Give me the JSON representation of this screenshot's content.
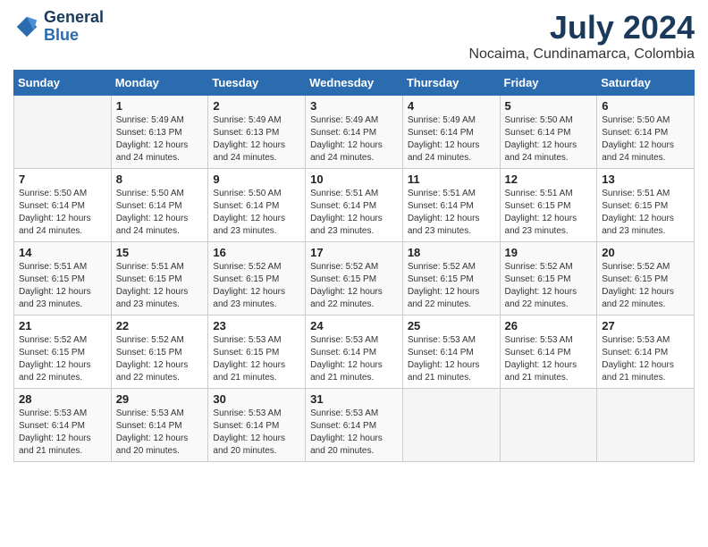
{
  "header": {
    "logo_line1": "General",
    "logo_line2": "Blue",
    "month": "July 2024",
    "location": "Nocaima, Cundinamarca, Colombia"
  },
  "weekdays": [
    "Sunday",
    "Monday",
    "Tuesday",
    "Wednesday",
    "Thursday",
    "Friday",
    "Saturday"
  ],
  "weeks": [
    [
      {
        "day": "",
        "sunrise": "",
        "sunset": "",
        "daylight": ""
      },
      {
        "day": "1",
        "sunrise": "Sunrise: 5:49 AM",
        "sunset": "Sunset: 6:13 PM",
        "daylight": "Daylight: 12 hours and 24 minutes."
      },
      {
        "day": "2",
        "sunrise": "Sunrise: 5:49 AM",
        "sunset": "Sunset: 6:13 PM",
        "daylight": "Daylight: 12 hours and 24 minutes."
      },
      {
        "day": "3",
        "sunrise": "Sunrise: 5:49 AM",
        "sunset": "Sunset: 6:14 PM",
        "daylight": "Daylight: 12 hours and 24 minutes."
      },
      {
        "day": "4",
        "sunrise": "Sunrise: 5:49 AM",
        "sunset": "Sunset: 6:14 PM",
        "daylight": "Daylight: 12 hours and 24 minutes."
      },
      {
        "day": "5",
        "sunrise": "Sunrise: 5:50 AM",
        "sunset": "Sunset: 6:14 PM",
        "daylight": "Daylight: 12 hours and 24 minutes."
      },
      {
        "day": "6",
        "sunrise": "Sunrise: 5:50 AM",
        "sunset": "Sunset: 6:14 PM",
        "daylight": "Daylight: 12 hours and 24 minutes."
      }
    ],
    [
      {
        "day": "7",
        "sunrise": "Sunrise: 5:50 AM",
        "sunset": "Sunset: 6:14 PM",
        "daylight": "Daylight: 12 hours and 24 minutes."
      },
      {
        "day": "8",
        "sunrise": "Sunrise: 5:50 AM",
        "sunset": "Sunset: 6:14 PM",
        "daylight": "Daylight: 12 hours and 24 minutes."
      },
      {
        "day": "9",
        "sunrise": "Sunrise: 5:50 AM",
        "sunset": "Sunset: 6:14 PM",
        "daylight": "Daylight: 12 hours and 23 minutes."
      },
      {
        "day": "10",
        "sunrise": "Sunrise: 5:51 AM",
        "sunset": "Sunset: 6:14 PM",
        "daylight": "Daylight: 12 hours and 23 minutes."
      },
      {
        "day": "11",
        "sunrise": "Sunrise: 5:51 AM",
        "sunset": "Sunset: 6:14 PM",
        "daylight": "Daylight: 12 hours and 23 minutes."
      },
      {
        "day": "12",
        "sunrise": "Sunrise: 5:51 AM",
        "sunset": "Sunset: 6:15 PM",
        "daylight": "Daylight: 12 hours and 23 minutes."
      },
      {
        "day": "13",
        "sunrise": "Sunrise: 5:51 AM",
        "sunset": "Sunset: 6:15 PM",
        "daylight": "Daylight: 12 hours and 23 minutes."
      }
    ],
    [
      {
        "day": "14",
        "sunrise": "Sunrise: 5:51 AM",
        "sunset": "Sunset: 6:15 PM",
        "daylight": "Daylight: 12 hours and 23 minutes."
      },
      {
        "day": "15",
        "sunrise": "Sunrise: 5:51 AM",
        "sunset": "Sunset: 6:15 PM",
        "daylight": "Daylight: 12 hours and 23 minutes."
      },
      {
        "day": "16",
        "sunrise": "Sunrise: 5:52 AM",
        "sunset": "Sunset: 6:15 PM",
        "daylight": "Daylight: 12 hours and 23 minutes."
      },
      {
        "day": "17",
        "sunrise": "Sunrise: 5:52 AM",
        "sunset": "Sunset: 6:15 PM",
        "daylight": "Daylight: 12 hours and 22 minutes."
      },
      {
        "day": "18",
        "sunrise": "Sunrise: 5:52 AM",
        "sunset": "Sunset: 6:15 PM",
        "daylight": "Daylight: 12 hours and 22 minutes."
      },
      {
        "day": "19",
        "sunrise": "Sunrise: 5:52 AM",
        "sunset": "Sunset: 6:15 PM",
        "daylight": "Daylight: 12 hours and 22 minutes."
      },
      {
        "day": "20",
        "sunrise": "Sunrise: 5:52 AM",
        "sunset": "Sunset: 6:15 PM",
        "daylight": "Daylight: 12 hours and 22 minutes."
      }
    ],
    [
      {
        "day": "21",
        "sunrise": "Sunrise: 5:52 AM",
        "sunset": "Sunset: 6:15 PM",
        "daylight": "Daylight: 12 hours and 22 minutes."
      },
      {
        "day": "22",
        "sunrise": "Sunrise: 5:52 AM",
        "sunset": "Sunset: 6:15 PM",
        "daylight": "Daylight: 12 hours and 22 minutes."
      },
      {
        "day": "23",
        "sunrise": "Sunrise: 5:53 AM",
        "sunset": "Sunset: 6:15 PM",
        "daylight": "Daylight: 12 hours and 21 minutes."
      },
      {
        "day": "24",
        "sunrise": "Sunrise: 5:53 AM",
        "sunset": "Sunset: 6:14 PM",
        "daylight": "Daylight: 12 hours and 21 minutes."
      },
      {
        "day": "25",
        "sunrise": "Sunrise: 5:53 AM",
        "sunset": "Sunset: 6:14 PM",
        "daylight": "Daylight: 12 hours and 21 minutes."
      },
      {
        "day": "26",
        "sunrise": "Sunrise: 5:53 AM",
        "sunset": "Sunset: 6:14 PM",
        "daylight": "Daylight: 12 hours and 21 minutes."
      },
      {
        "day": "27",
        "sunrise": "Sunrise: 5:53 AM",
        "sunset": "Sunset: 6:14 PM",
        "daylight": "Daylight: 12 hours and 21 minutes."
      }
    ],
    [
      {
        "day": "28",
        "sunrise": "Sunrise: 5:53 AM",
        "sunset": "Sunset: 6:14 PM",
        "daylight": "Daylight: 12 hours and 21 minutes."
      },
      {
        "day": "29",
        "sunrise": "Sunrise: 5:53 AM",
        "sunset": "Sunset: 6:14 PM",
        "daylight": "Daylight: 12 hours and 20 minutes."
      },
      {
        "day": "30",
        "sunrise": "Sunrise: 5:53 AM",
        "sunset": "Sunset: 6:14 PM",
        "daylight": "Daylight: 12 hours and 20 minutes."
      },
      {
        "day": "31",
        "sunrise": "Sunrise: 5:53 AM",
        "sunset": "Sunset: 6:14 PM",
        "daylight": "Daylight: 12 hours and 20 minutes."
      },
      {
        "day": "",
        "sunrise": "",
        "sunset": "",
        "daylight": ""
      },
      {
        "day": "",
        "sunrise": "",
        "sunset": "",
        "daylight": ""
      },
      {
        "day": "",
        "sunrise": "",
        "sunset": "",
        "daylight": ""
      }
    ]
  ]
}
